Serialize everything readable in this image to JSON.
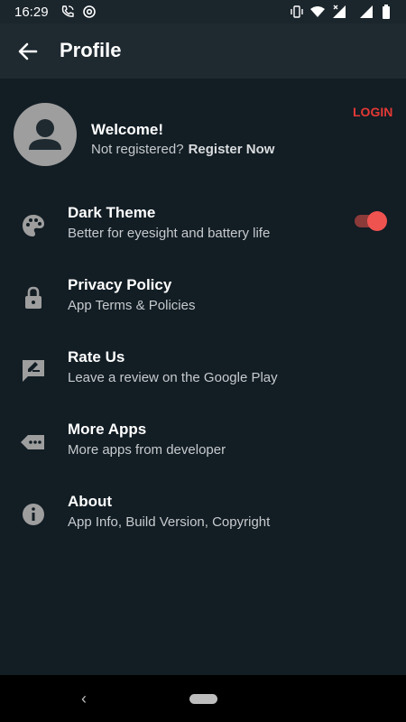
{
  "status_bar": {
    "time": "16:29"
  },
  "app_bar": {
    "title": "Profile"
  },
  "profile": {
    "welcome": "Welcome!",
    "not_registered": "Not registered?",
    "register_now": "Register Now",
    "login": "LOGIN"
  },
  "settings": [
    {
      "label": "Dark Theme",
      "sub": "Better for eyesight and battery life",
      "icon": "palette-icon",
      "toggle_on": true
    },
    {
      "label": "Privacy Policy",
      "sub": "App Terms & Policies",
      "icon": "lock-icon"
    },
    {
      "label": "Rate Us",
      "sub": "Leave a review on the Google Play",
      "icon": "rate-review-icon"
    },
    {
      "label": "More Apps",
      "sub": "More apps from developer",
      "icon": "more-apps-icon"
    },
    {
      "label": "About",
      "sub": "App Info, Build Version, Copyright",
      "icon": "info-icon"
    }
  ],
  "colors": {
    "background": "#121d24",
    "app_bar": "#1e2930",
    "accent": "#e53935",
    "text_secondary": "#c7cbce"
  }
}
